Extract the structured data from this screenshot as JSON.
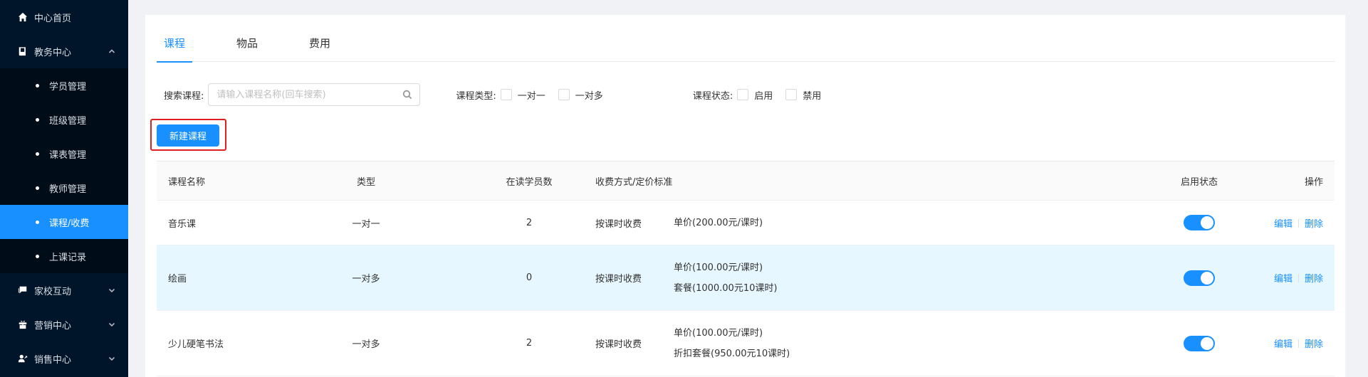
{
  "sidebar": {
    "home": "中心首页",
    "academic": "教务中心",
    "sub_items": [
      "学员管理",
      "班级管理",
      "课表管理",
      "教师管理",
      "课程/收费",
      "上课记录"
    ],
    "home_school": "家校互动",
    "marketing": "营销中心",
    "sales": "销售中心"
  },
  "tabs": [
    "课程",
    "物品",
    "费用"
  ],
  "filters": {
    "search_label": "搜索课程:",
    "search_placeholder": "请输入课程名称(回车搜索)",
    "type_label": "课程类型:",
    "type_options": [
      "一对一",
      "一对多"
    ],
    "status_label": "课程状态:",
    "status_options": [
      "启用",
      "禁用"
    ]
  },
  "new_button": "新建课程",
  "table": {
    "headers": {
      "name": "课程名称",
      "type": "类型",
      "count": "在读学员数",
      "fee": "收费方式/定价标准",
      "status": "启用状态",
      "ops": "操作"
    },
    "rows": [
      {
        "name": "音乐课",
        "type": "一对一",
        "count": "2",
        "method": "按课时收费",
        "prices": [
          "单价(200.00元/课时)"
        ]
      },
      {
        "name": "绘画",
        "type": "一对多",
        "count": "0",
        "method": "按课时收费",
        "prices": [
          "单价(100.00元/课时)",
          "套餐(1000.00元10课时)"
        ]
      },
      {
        "name": "少儿硬笔书法",
        "type": "一对多",
        "count": "2",
        "method": "按课时收费",
        "prices": [
          "单价(100.00元/课时)",
          "折扣套餐(950.00元10课时)"
        ]
      }
    ],
    "edit": "编辑",
    "delete": "删除"
  }
}
